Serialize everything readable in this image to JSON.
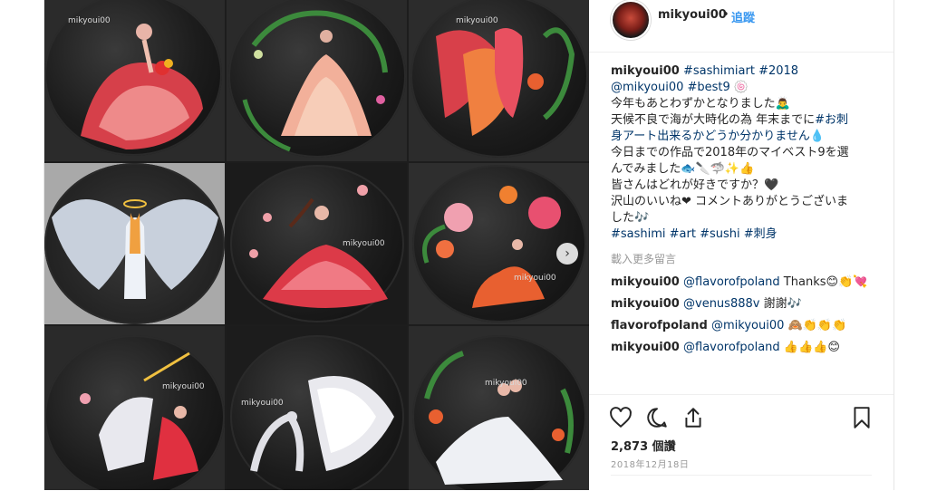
{
  "photo": {
    "watermark": "mikyoui00",
    "tile_watermark_small": "mikyoui00"
  },
  "header": {
    "username": "mikyoui00",
    "separator": "•",
    "follow_label": "追蹤"
  },
  "caption": {
    "username": "mikyoui00",
    "lines": [
      {
        "segments": [
          {
            "t": "#sashimiart #2018",
            "link": true
          }
        ]
      },
      {
        "segments": [
          {
            "t": "@mikyoui00 #best9",
            "link": true
          },
          {
            "t": " 🍥",
            "link": false
          }
        ]
      },
      {
        "segments": [
          {
            "t": "今年もあとわずかとなりました🙇‍♂",
            "link": false
          }
        ]
      },
      {
        "segments": [
          {
            "t": "天候不良で海が大時化の為 年末までに",
            "link": false
          },
          {
            "t": "#お刺",
            "link": true
          }
        ]
      },
      {
        "segments": [
          {
            "t": "身アート出来るかどうか分かりません",
            "link": true
          },
          {
            "t": "💧",
            "link": false
          }
        ]
      },
      {
        "segments": [
          {
            "t": "今日までの作品で2018年のマイベスト9を選",
            "link": false
          }
        ]
      },
      {
        "segments": [
          {
            "t": "んでみました🐟🔪🦈✨👍",
            "link": false
          }
        ]
      },
      {
        "segments": [
          {
            "t": "皆さんはどれが好きですか？🖤",
            "link": false
          }
        ]
      },
      {
        "segments": [
          {
            "t": "沢山のいいね❤ コメントありがとうございま",
            "link": false
          }
        ]
      },
      {
        "segments": [
          {
            "t": "した🎶",
            "link": false
          }
        ]
      },
      {
        "segments": [
          {
            "t": "#sashimi #art #sushi #刺身",
            "link": true
          }
        ]
      }
    ]
  },
  "load_more": "載入更多留言",
  "comments": [
    {
      "user": "mikyoui00",
      "mention": "@flavorofpoland",
      "text": " Thanks😊👏💘"
    },
    {
      "user": "mikyoui00",
      "mention": "@venus888v",
      "text": " 謝謝🎶"
    },
    {
      "user": "flavorofpoland",
      "mention": "@mikyoui00",
      "text": " 🙈👏👏👏"
    },
    {
      "user": "mikyoui00",
      "mention": "@flavorofpoland",
      "text": " 👍👍👍😊"
    }
  ],
  "actions": {
    "like_icon": "heart-icon",
    "comment_icon": "comment-bubble-icon",
    "share_icon": "share-icon",
    "save_icon": "bookmark-icon",
    "likes_text": "2,873 個讚",
    "date_text": "2018年12月18日"
  },
  "colors": {
    "link": "#003569",
    "follow": "#3897f0",
    "muted": "#999999",
    "text": "#262626"
  }
}
